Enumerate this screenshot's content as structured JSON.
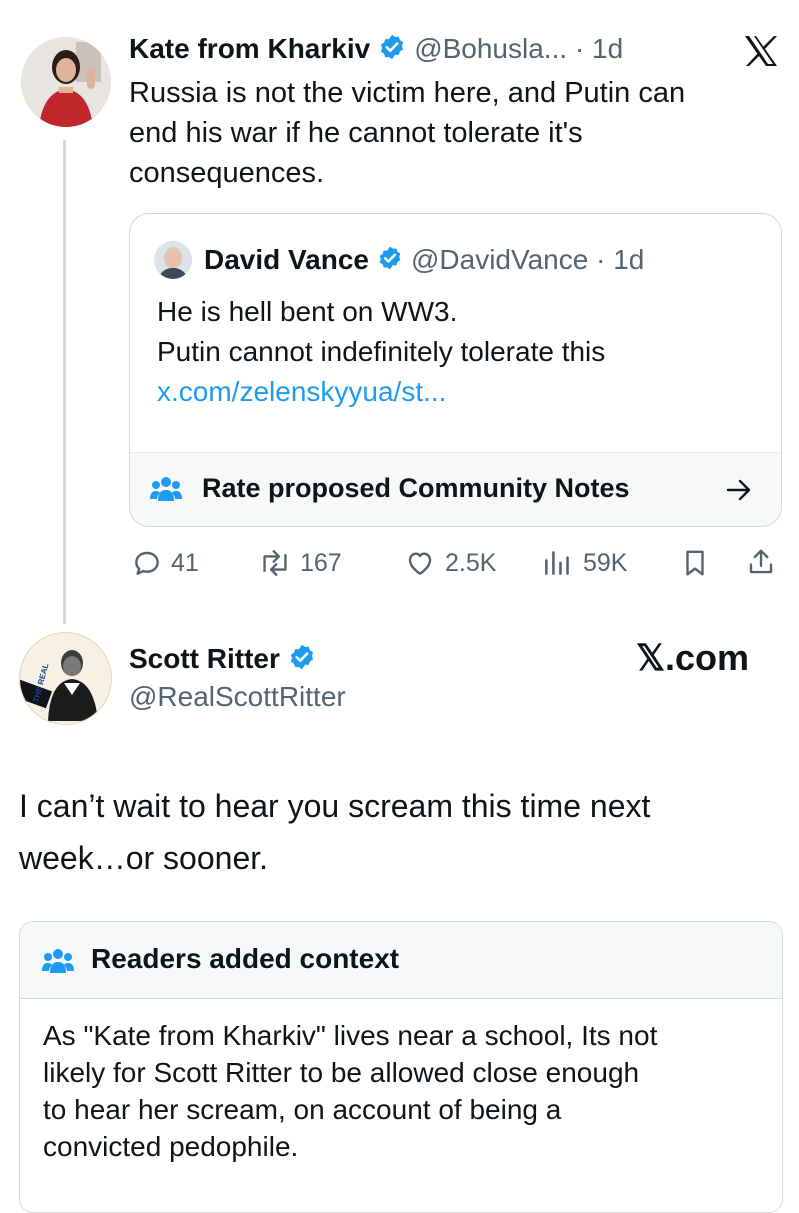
{
  "reply": {
    "author_name": "Kate from Kharkiv",
    "handle_time": "@Bohusla... · 1d",
    "body": [
      "Russia is not the victim here, and Putin can",
      "end his war if he cannot tolerate it's",
      "consequences."
    ]
  },
  "quote": {
    "author_name": "David Vance",
    "handle_time": "@DavidVance · 1d",
    "line1": "He is hell bent on WW3.",
    "line2": "Putin cannot indefinitely tolerate this",
    "link": "x.com/zelenskyyua/st...",
    "notes_label": "Rate proposed Community Notes"
  },
  "actions": {
    "replies": "41",
    "reposts": "167",
    "likes": "2.5K",
    "views": "59K"
  },
  "main": {
    "author_name": "Scott Ritter",
    "handle": "@RealScottRitter",
    "avatar_text": "THE REAL SCOTT RITTER",
    "brand": "𝕏.com",
    "body": [
      "I can’t wait to hear you scream this time next",
      "week…or sooner."
    ]
  },
  "context": {
    "title": "Readers added context",
    "body": [
      "As \"Kate from Kharkiv\" lives near a school, Its not",
      "likely for Scott Ritter to be allowed close enough",
      "to hear her scream, on account of being a",
      "convicted pedophile."
    ]
  },
  "colors": {
    "verified": "#1d9bf0",
    "link": "#1d9bf0",
    "muted": "#536471",
    "border": "#cfd9de"
  }
}
